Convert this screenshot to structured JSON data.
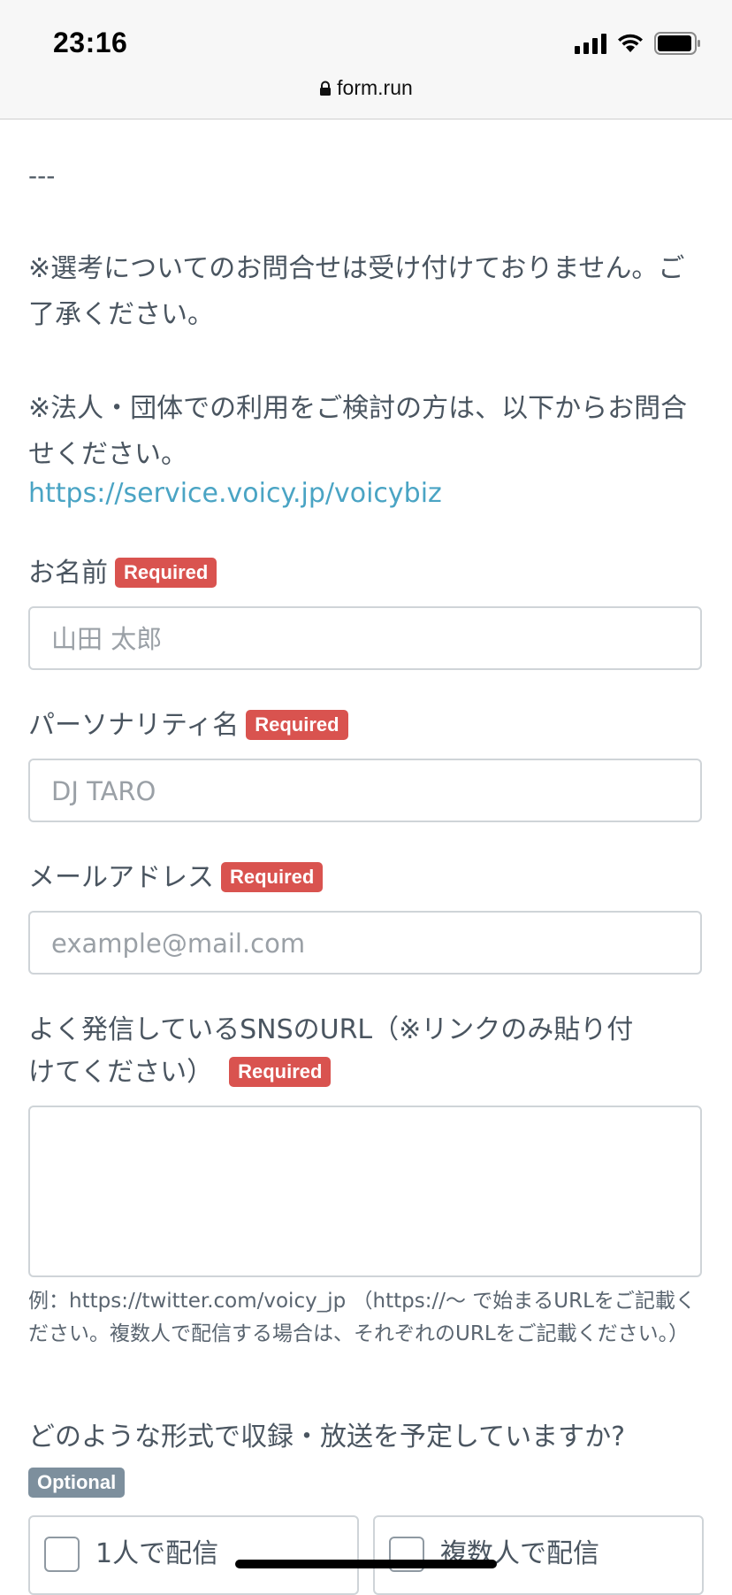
{
  "status_bar": {
    "time": "23:16",
    "url": "form.run",
    "icons": [
      "signal-icon",
      "wifi-icon",
      "battery-icon",
      "lock-icon"
    ]
  },
  "intro": {
    "divider": "---",
    "note1": "※選考についてのお問合せは受け付けておりません。ご了承ください。",
    "note2": "※法人・団体での利用をご検討の方は、以下からお問合せください。",
    "link": "https://service.voicy.jp/voicybiz"
  },
  "badges": {
    "required": "Required",
    "optional": "Optional"
  },
  "fields": {
    "name": {
      "label": "お名前",
      "placeholder": "山田 太郎"
    },
    "personality": {
      "label": "パーソナリティ名",
      "placeholder": "DJ TARO"
    },
    "email": {
      "label": "メールアドレス",
      "placeholder": "example@mail.com"
    },
    "sns": {
      "label_line1": "よく発信しているSNSのURL（※リンクのみ貼り付",
      "label_line2": "けてください）",
      "help": "例：https://twitter.com/voicy_jp （https://〜 で始まるURLをご記載ください。複数人で配信する場合は、それぞれのURLをご記載ください。）"
    }
  },
  "format_question": {
    "label": "どのような形式で収録・放送を予定していますか?",
    "options": [
      "1人で配信",
      "複数人で配信"
    ]
  },
  "colors": {
    "required_badge": "#d9534f",
    "optional_badge": "#7d8f9d",
    "link": "#4aa4c4",
    "text": "#4a5560"
  }
}
